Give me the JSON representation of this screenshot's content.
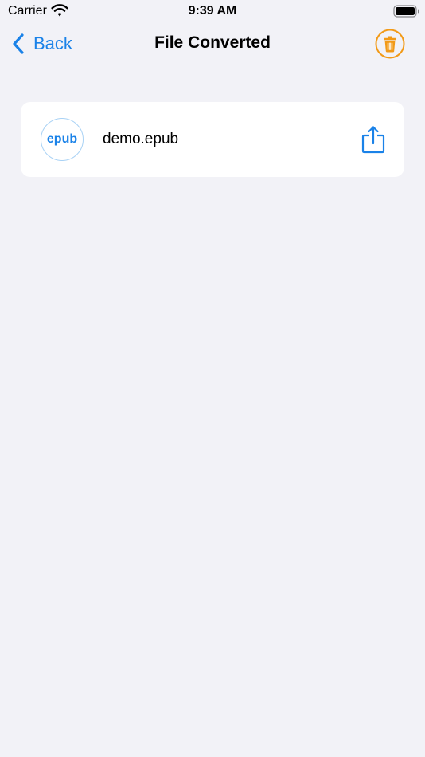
{
  "status_bar": {
    "carrier": "Carrier",
    "time": "9:39 AM",
    "wifi_icon": "wifi-icon",
    "battery_icon": "battery-icon"
  },
  "nav": {
    "back_label": "Back",
    "back_icon": "chevron-left-icon",
    "title": "File Converted",
    "trash_icon": "trash-icon"
  },
  "files": [
    {
      "badge": "epub",
      "name": "demo.epub",
      "share_icon": "share-icon"
    }
  ],
  "colors": {
    "background": "#F2F2F7",
    "accent_blue": "#1A82E8",
    "trash_orange": "#F29A17",
    "card": "#FFFFFF"
  }
}
